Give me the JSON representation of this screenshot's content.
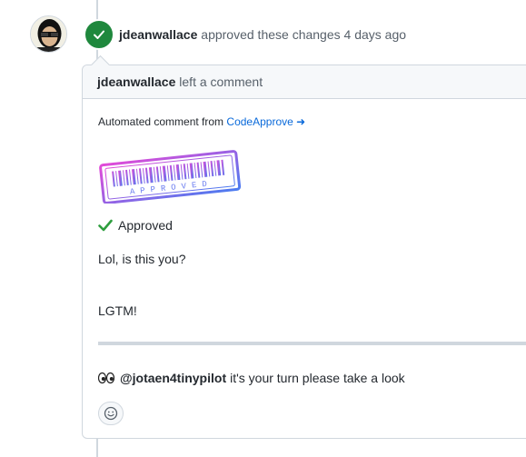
{
  "review_event": {
    "author": "jdeanwallace",
    "action_text": "approved these changes",
    "time_ago": "4 days ago",
    "status_icon": "check-icon",
    "status_color": "#1f883d"
  },
  "comment": {
    "header_author": "jdeanwallace",
    "header_action": "left a comment",
    "automated_prefix": "Automated comment from",
    "automated_link": "CodeApprove ➜",
    "stamp_text": "APPROVED",
    "approved_label": "Approved",
    "question": "Lol, is this you?",
    "lgtm": "LGTM!",
    "mention_user": "@jotaen4tinypilot",
    "mention_text": "it's your turn please take a look",
    "eyes_icon": "eyes-icon",
    "reaction_icon": "smiley-icon"
  },
  "colors": {
    "accent": "#0969da",
    "success": "#1f883d",
    "border": "#d0d7de",
    "header_bg": "#f6f8fa"
  }
}
